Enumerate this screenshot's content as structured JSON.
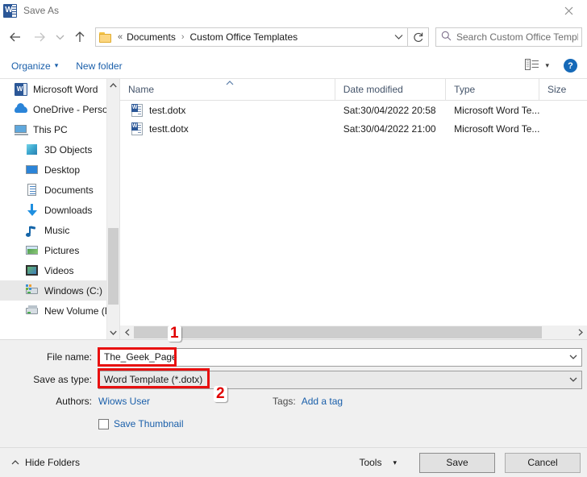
{
  "window": {
    "title": "Save As",
    "app_icon": "word-icon",
    "close_label": "✕"
  },
  "nav": {
    "back": "←",
    "forward": "→",
    "recent": "⌄",
    "up": "↑",
    "refresh": "↻",
    "address_chevron": "⌄",
    "breadcrumb": {
      "folder_icon": "folder-icon",
      "overflow": "«",
      "separator": "›",
      "items": [
        "Documents",
        "Custom Office Templates"
      ]
    }
  },
  "search": {
    "icon": "search-icon",
    "placeholder": "Search Custom Office Templ..."
  },
  "toolbar": {
    "organize_label": "Organize",
    "organize_caret": "▾",
    "new_folder_label": "New folder",
    "view_icon": "view-layout-icon",
    "view_caret": "▾",
    "help_label": "?"
  },
  "sidebar": {
    "items": [
      {
        "label": "Microsoft Word",
        "icon": "word-icon",
        "indent": false,
        "selected": false
      },
      {
        "label": "OneDrive - Persor",
        "icon": "cloud-icon",
        "indent": false,
        "selected": false
      },
      {
        "label": "This PC",
        "icon": "computer-icon",
        "indent": false,
        "selected": false
      },
      {
        "label": "3D Objects",
        "icon": "cube-icon",
        "indent": true,
        "selected": false
      },
      {
        "label": "Desktop",
        "icon": "desktop-icon",
        "indent": true,
        "selected": false
      },
      {
        "label": "Documents",
        "icon": "documents-icon",
        "indent": true,
        "selected": false
      },
      {
        "label": "Downloads",
        "icon": "download-arrow-icon",
        "indent": true,
        "selected": false
      },
      {
        "label": "Music",
        "icon": "music-note-icon",
        "indent": true,
        "selected": false
      },
      {
        "label": "Pictures",
        "icon": "picture-icon",
        "indent": true,
        "selected": false
      },
      {
        "label": "Videos",
        "icon": "video-film-icon",
        "indent": true,
        "selected": false
      },
      {
        "label": "Windows (C:)",
        "icon": "windows-drive-icon",
        "indent": true,
        "selected": true
      },
      {
        "label": "New Volume (D:)",
        "icon": "hard-drive-icon",
        "indent": true,
        "selected": false
      }
    ],
    "scroll_up": "⌃",
    "scroll_down": "⌄"
  },
  "filelist": {
    "columns": [
      "Name",
      "Date modified",
      "Type",
      "Size"
    ],
    "sort_indicator": "⌃",
    "rows": [
      {
        "name": "test.dotx",
        "date": "Sat:30/04/2022 20:58",
        "type": "Microsoft Word Te...",
        "size": "",
        "icon": "word-document-icon"
      },
      {
        "name": "testt.dotx",
        "date": "Sat:30/04/2022 21:00",
        "type": "Microsoft Word Te...",
        "size": "",
        "icon": "word-document-icon"
      }
    ],
    "hscroll_left": "‹",
    "hscroll_right": "›"
  },
  "form": {
    "file_name_label": "File name:",
    "file_name_value": "The_Geek_Page",
    "save_as_type_label": "Save as type:",
    "save_as_type_value": "Word Template (*.dotx)",
    "combo_arrow": "⌄",
    "authors_label": "Authors:",
    "authors_value": "Wiows User",
    "tags_label": "Tags:",
    "tags_value": "Add a tag",
    "thumbnail_label": "Save Thumbnail",
    "thumbnail_checked": false
  },
  "bottom": {
    "hide_folders_label": "Hide Folders",
    "hide_folders_caret": "⌃",
    "tools_label": "Tools",
    "tools_caret": "▾",
    "save_label": "Save",
    "cancel_label": "Cancel"
  },
  "annotations": {
    "badge_one": "1",
    "badge_two": "2",
    "color": "#e81010"
  }
}
